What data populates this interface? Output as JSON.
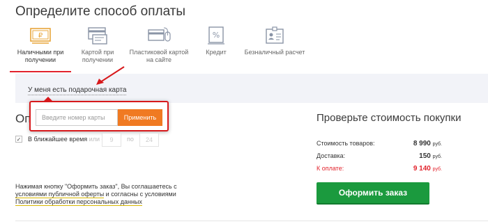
{
  "page_title": "Определите способ оплаты",
  "payment_methods": [
    {
      "label": "Наличными при получении",
      "icon": "cash-ruble-icon",
      "active": true
    },
    {
      "label": "Картой при получении",
      "icon": "card-terminal-icon",
      "active": false
    },
    {
      "label": "Пластиковой картой на сайте",
      "icon": "card-mouse-icon",
      "active": false
    },
    {
      "label": "Кредит",
      "icon": "percent-document-icon",
      "active": false
    },
    {
      "label": "Безналичный расчет",
      "icon": "id-badge-icon",
      "active": false
    }
  ],
  "gift_card": {
    "link_label": "У меня есть подарочная карта",
    "input_placeholder": "Введите номер карты",
    "apply_label": "Применить"
  },
  "delivery_section": {
    "heading": "Оп",
    "nearest_time_label": "В ближайшее время",
    "or_from": "или с",
    "from_value": "9",
    "to_label": "по",
    "to_value": "24",
    "checked": true
  },
  "agreement": {
    "text_before": "Нажимая кнопку \"Оформить заказ\", Вы соглашаетесь с ",
    "public_offer_link": "условиями публичной оферты",
    "text_middle": " и согласны с условиями ",
    "privacy_link": "Политики обработки персональных данных"
  },
  "summary": {
    "title": "Проверьте стоимость покупки",
    "goods_label": "Стоимость товаров:",
    "goods_value": "8 990",
    "delivery_label": "Доставка:",
    "delivery_value": "150",
    "total_label": "К оплате:",
    "total_value": "9 140",
    "currency": "руб.",
    "order_button": "Оформить заказ"
  },
  "colors": {
    "accent_red": "#e2232c",
    "apply_orange": "#f07a22",
    "order_green": "#1b9a3e",
    "band_bg": "#f2f3f8"
  }
}
